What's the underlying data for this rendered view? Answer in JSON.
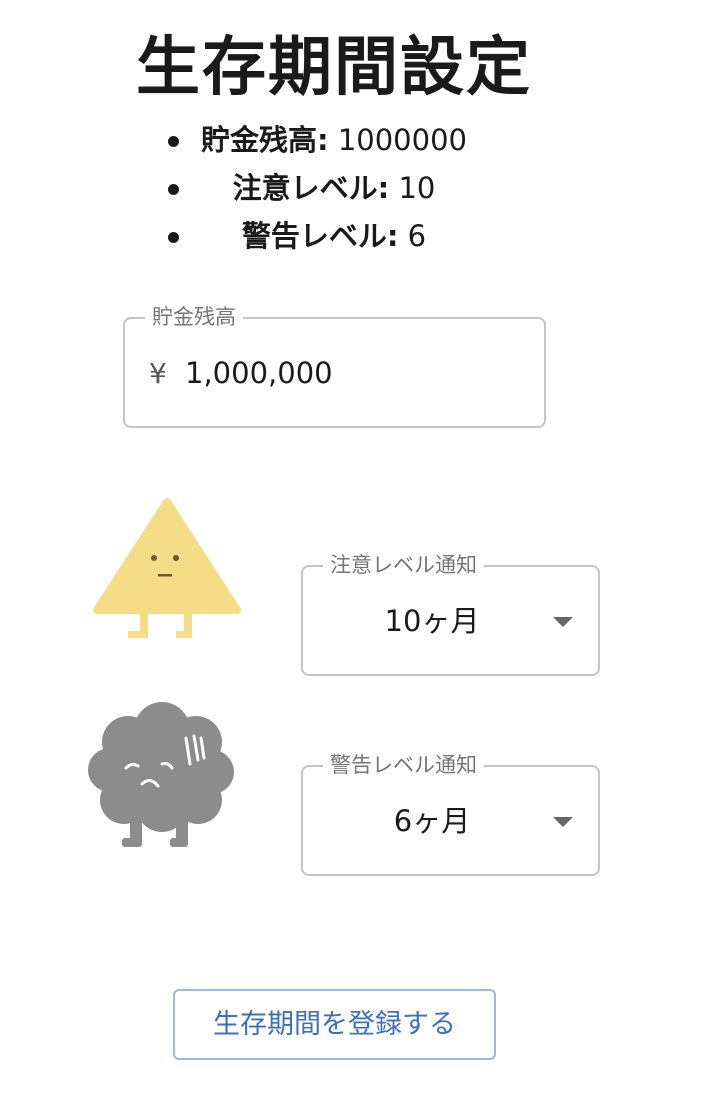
{
  "page": {
    "title": "生存期間設定"
  },
  "summary": [
    {
      "label": "貯金残高:",
      "value": " 1000000"
    },
    {
      "label": "注意レベル:",
      "value": " 10"
    },
    {
      "label": "警告レベル:",
      "value": " 6"
    }
  ],
  "savings": {
    "label": "貯金残高",
    "currency_symbol": "¥",
    "value": "1,000,000"
  },
  "caution": {
    "label": "注意レベル通知",
    "selected": "10ヶ月",
    "color": "#f5dd85"
  },
  "warning": {
    "label": "警告レベル通知",
    "selected": "6ヶ月",
    "color": "#8c8c8c"
  },
  "register_button": {
    "label": "生存期間を登録する"
  },
  "icons": {
    "caution_mascot": "triangle-character-icon",
    "warning_mascot": "cloud-character-icon",
    "dropdown": "caret-down-icon"
  }
}
